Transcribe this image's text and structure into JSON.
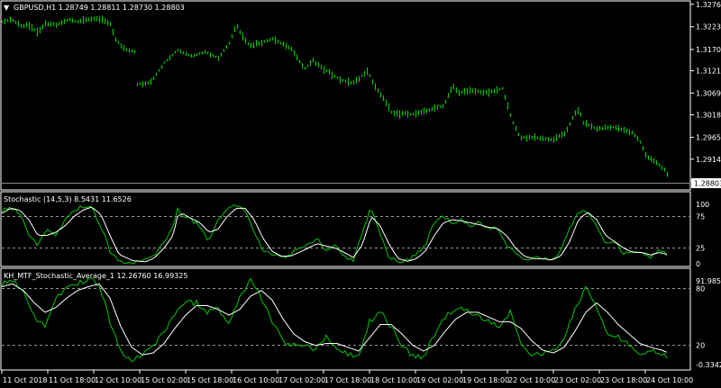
{
  "colors": {
    "background": "#000000",
    "bars": "#00c800",
    "fast": "#00c800",
    "slow": "#ffffff",
    "border": "#ffffff",
    "level": "#c8c8c8"
  },
  "main": {
    "collapse_glyph": "▼",
    "title": "GBPUSD,H1  1.28749 1.28811 1.28730 1.28803",
    "price_ticks": [
      "1.32762",
      "1.32237",
      "1.31707",
      "1.31211",
      "1.30692",
      "1.30182",
      "1.29657",
      "1.29147",
      "1.28637"
    ],
    "current_price": "1.28803",
    "ylim": [
      1.2845,
      1.3282
    ]
  },
  "stoch": {
    "title": "Stochastic (14,5,3) 8.5431 11.6526",
    "ticks": [
      "100",
      "75",
      "25",
      "0"
    ],
    "levels": [
      75,
      25
    ],
    "ylim": [
      0,
      100
    ]
  },
  "kh": {
    "title": "KH_MTF_Stochastic_Average_1 12.26760 16.99325",
    "ticks": [
      "91.9857",
      "80",
      "20",
      "-0.33429"
    ],
    "levels": [
      80,
      20
    ],
    "ylim": [
      -0.33429,
      91.9857
    ]
  },
  "time_axis": [
    "11 Oct 2018",
    "11 Oct 18:00",
    "12 Oct 10:00",
    "15 Oct 02:00",
    "15 Oct 18:00",
    "16 Oct 10:00",
    "17 Oct 02:00",
    "17 Oct 18:00",
    "18 Oct 10:00",
    "19 Oct 02:00",
    "19 Oct 18:00",
    "22 Oct 10:00",
    "23 Oct 02:00",
    "23 Oct 18:00",
    "24 Oct 10:00"
  ],
  "chart_data": [
    {
      "type": "line",
      "name": "GBPUSD,H1 price bars",
      "keypoints_x": [
        0,
        10,
        22,
        30,
        40,
        48,
        60,
        75,
        85,
        100,
        110,
        120,
        126,
        135,
        148,
        150,
        165,
        180,
        195,
        210,
        225,
        240,
        252,
        260,
        265,
        275,
        285,
        300,
        320,
        335,
        345,
        360,
        375,
        390,
        405,
        415,
        425,
        432,
        440,
        455,
        475,
        490,
        500,
        507,
        520,
        540,
        555,
        565,
        570,
        575,
        590,
        610,
        625,
        635,
        640,
        645,
        660,
        680,
        700,
        708,
        715,
        725,
        735,
        738
      ],
      "keypoints_y": [
        1.3235,
        1.324,
        1.3225,
        1.3228,
        1.321,
        1.3232,
        1.3228,
        1.324,
        1.3235,
        1.3243,
        1.3242,
        1.323,
        1.3195,
        1.3172,
        1.3165,
        1.309,
        1.3095,
        1.314,
        1.317,
        1.3155,
        1.3165,
        1.315,
        1.3185,
        1.323,
        1.3205,
        1.318,
        1.3185,
        1.3195,
        1.3175,
        1.3125,
        1.3145,
        1.312,
        1.31,
        1.3092,
        1.312,
        1.308,
        1.305,
        1.3025,
        1.302,
        1.302,
        1.303,
        1.304,
        1.3085,
        1.307,
        1.3075,
        1.307,
        1.308,
        1.301,
        1.2985,
        1.2965,
        1.2965,
        1.296,
        1.2975,
        1.302,
        1.303,
        1.3,
        1.2985,
        1.299,
        1.2975,
        1.2955,
        1.292,
        1.2908,
        1.289,
        1.288
      ]
    },
    {
      "type": "line",
      "name": "Stochastic (14,5,3)",
      "keypoints_x": [
        0,
        10,
        20,
        30,
        40,
        50,
        60,
        70,
        80,
        90,
        100,
        110,
        120,
        130,
        145,
        160,
        170,
        180,
        190,
        195,
        200,
        210,
        220,
        230,
        240,
        250,
        260,
        270,
        280,
        290,
        300,
        310,
        320,
        330,
        340,
        350,
        360,
        370,
        380,
        390,
        400,
        410,
        420,
        430,
        440,
        450,
        460,
        470,
        480,
        490,
        500,
        510,
        520,
        530,
        540,
        550,
        560,
        570,
        580,
        590,
        600,
        610,
        620,
        630,
        640,
        650,
        660,
        670,
        680,
        690,
        700,
        710,
        720,
        730,
        740
      ],
      "series": [
        {
          "values": [
            85,
            90,
            80,
            45,
            30,
            55,
            45,
            70,
            85,
            92,
            88,
            60,
            20,
            5,
            2,
            5,
            15,
            35,
            60,
            88,
            75,
            70,
            60,
            35,
            70,
            85,
            92,
            85,
            50,
            20,
            15,
            10,
            15,
            25,
            30,
            40,
            20,
            30,
            10,
            5,
            50,
            90,
            45,
            10,
            3,
            5,
            15,
            30,
            65,
            75,
            65,
            70,
            60,
            65,
            55,
            58,
            30,
            15,
            5,
            10,
            8,
            5,
            20,
            55,
            85,
            80,
            60,
            30,
            35,
            15,
            20,
            20,
            10,
            25,
            10
          ]
        },
        {
          "values": [
            80,
            88,
            85,
            70,
            45,
            45,
            50,
            60,
            75,
            85,
            90,
            78,
            45,
            15,
            5,
            3,
            10,
            25,
            45,
            75,
            80,
            72,
            65,
            50,
            55,
            75,
            88,
            88,
            70,
            40,
            20,
            12,
            12,
            18,
            25,
            32,
            28,
            25,
            18,
            10,
            30,
            75,
            60,
            30,
            8,
            4,
            8,
            20,
            45,
            65,
            70,
            68,
            65,
            62,
            58,
            56,
            45,
            25,
            12,
            8,
            8,
            6,
            12,
            35,
            70,
            82,
            70,
            45,
            35,
            25,
            18,
            18,
            14,
            18,
            14
          ]
        }
      ]
    },
    {
      "type": "line",
      "name": "KH_MTF_Stochastic_Average_1",
      "keypoints_x": [
        0,
        12,
        24,
        36,
        48,
        60,
        72,
        84,
        96,
        108,
        120,
        132,
        144,
        156,
        168,
        180,
        192,
        204,
        216,
        228,
        240,
        252,
        264,
        276,
        288,
        300,
        312,
        324,
        336,
        348,
        360,
        372,
        384,
        396,
        408,
        420,
        432,
        444,
        456,
        468,
        480,
        492,
        504,
        516,
        528,
        540,
        552,
        564,
        576,
        588,
        600,
        612,
        624,
        636,
        648,
        660,
        672,
        684,
        696,
        708,
        720,
        732,
        740
      ],
      "series": [
        {
          "values": [
            85,
            90,
            75,
            50,
            40,
            70,
            82,
            86,
            90,
            85,
            45,
            15,
            5,
            8,
            20,
            35,
            55,
            65,
            65,
            55,
            60,
            40,
            70,
            90,
            70,
            45,
            25,
            20,
            20,
            15,
            30,
            15,
            10,
            8,
            45,
            55,
            40,
            20,
            8,
            8,
            30,
            50,
            60,
            58,
            50,
            45,
            40,
            55,
            20,
            10,
            10,
            15,
            25,
            60,
            80,
            60,
            30,
            28,
            20,
            12,
            15,
            12,
            5
          ]
        },
        {
          "values": [
            82,
            85,
            78,
            65,
            55,
            60,
            70,
            78,
            82,
            85,
            70,
            40,
            18,
            10,
            12,
            22,
            38,
            52,
            62,
            62,
            58,
            52,
            58,
            72,
            78,
            68,
            48,
            32,
            24,
            20,
            22,
            22,
            18,
            14,
            28,
            42,
            42,
            32,
            20,
            14,
            20,
            35,
            48,
            55,
            55,
            50,
            45,
            45,
            38,
            25,
            15,
            12,
            18,
            35,
            55,
            65,
            55,
            42,
            32,
            22,
            18,
            15,
            12
          ]
        }
      ]
    }
  ]
}
